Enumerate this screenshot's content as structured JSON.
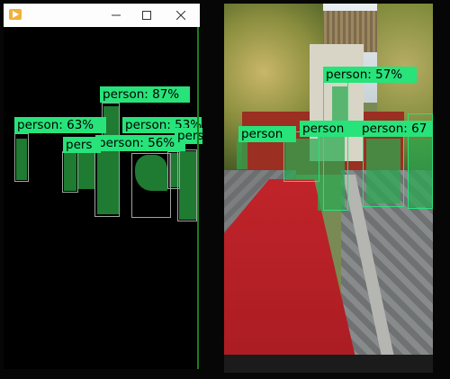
{
  "window": {
    "title": "",
    "app_icon": "video-player-icon",
    "controls": {
      "minimize": "minimize-icon",
      "maximize": "maximize-icon",
      "close": "close-icon"
    }
  },
  "left_detections": [
    {
      "label": "person: 87%"
    },
    {
      "label": "person: 63%"
    },
    {
      "label": "person: 53%"
    },
    {
      "label": "person: 56%"
    },
    {
      "label": "perso"
    },
    {
      "label": "pers"
    }
  ],
  "right_detections": [
    {
      "label": "person: 57%"
    },
    {
      "label": "person"
    },
    {
      "label": "person"
    },
    {
      "label": "person: 67"
    }
  ],
  "colors": {
    "label_background": "#27e37a",
    "mask_left": "#1f7a32",
    "box_border": "#9fa59f",
    "carpet": "#c0242a"
  }
}
